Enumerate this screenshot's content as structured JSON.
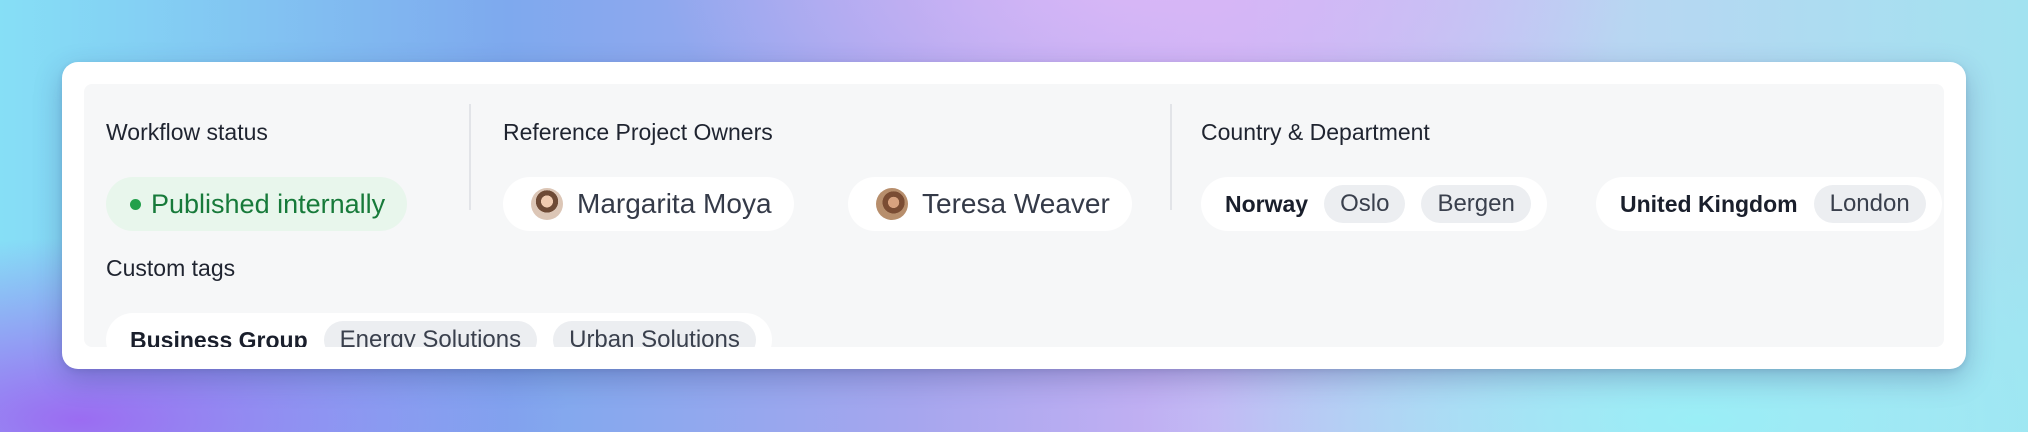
{
  "workflow": {
    "label": "Workflow status",
    "status": "Published internally",
    "status_color": "#177a3a"
  },
  "owners": {
    "label": "Reference Project Owners",
    "people": [
      {
        "name": "Margarita Moya",
        "avatar": "avatar-icon"
      },
      {
        "name": "Teresa Weaver",
        "avatar": "avatar-icon"
      }
    ]
  },
  "country_department": {
    "label": "Country & Department",
    "groups": [
      {
        "country": "Norway",
        "departments": [
          "Oslo",
          "Bergen"
        ]
      },
      {
        "country": "United Kingdom",
        "departments": [
          "London"
        ]
      }
    ]
  },
  "custom_tags": {
    "label": "Custom tags",
    "group": "Business Group",
    "tags": [
      "Energy Solutions",
      "Urban Solutions"
    ]
  }
}
